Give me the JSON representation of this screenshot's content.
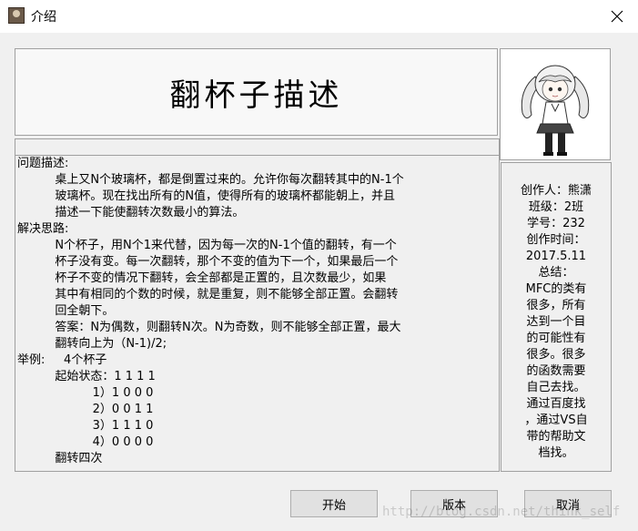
{
  "window": {
    "title": "介绍",
    "icon": "avatar-app-icon",
    "close_icon": "close-icon"
  },
  "header": {
    "title": "翻杯子描述"
  },
  "avatar": {
    "icon": "anime-girl-avatar"
  },
  "description": {
    "text": "问题描述:\n          桌上又N个玻璃杯，都是倒置过来的。允许你每次翻转其中的N-1个\n          玻璃杯。现在找出所有的N值，使得所有的玻璃杯都能朝上，并且\n          描述一下能使翻转次数最小的算法。\n解决思路:\n          N个杯子，用N个1来代替，因为每一次的N-1个值的翻转，有一个\n          杯子没有变。每一次翻转，那个不变的值为下一个，如果最后一个\n          杯子不变的情况下翻转，会全部都是正置的，且次数最少，如果\n          其中有相同的个数的时候，就是重复，则不能够全部正置。会翻转\n          回全朝下。\n          答案：N为偶数，则翻转N次。N为奇数，则不能够全部正置，最大\n          翻转向上为（N-1)/2;\n举例:     4个杯子\n          起始状态：1 1 1 1\n                    1）1 0 0 0\n                    2）0 0 1 1\n                    3）1 1 1 0\n                    4）0 0 0 0\n          翻转四次"
  },
  "info": {
    "text": "创作人：熊潇\n班级：2班\n学号：232\n创作时间：\n2017.5.11\n总结：\nMFC的类有\n很多，所有\n达到一个目\n的可能性有\n很多。很多\n的函数需要\n自己去找。\n通过百度找\n，通过VS自\n带的帮助文\n档找。"
  },
  "buttons": {
    "start": "开始",
    "version": "版本",
    "cancel": "取消"
  },
  "watermark": "http://blog.csdn.net/think_self",
  "colors": {
    "background": "#f0f0f0",
    "border": "#a0a0a0",
    "button": "#e1e1e1"
  }
}
